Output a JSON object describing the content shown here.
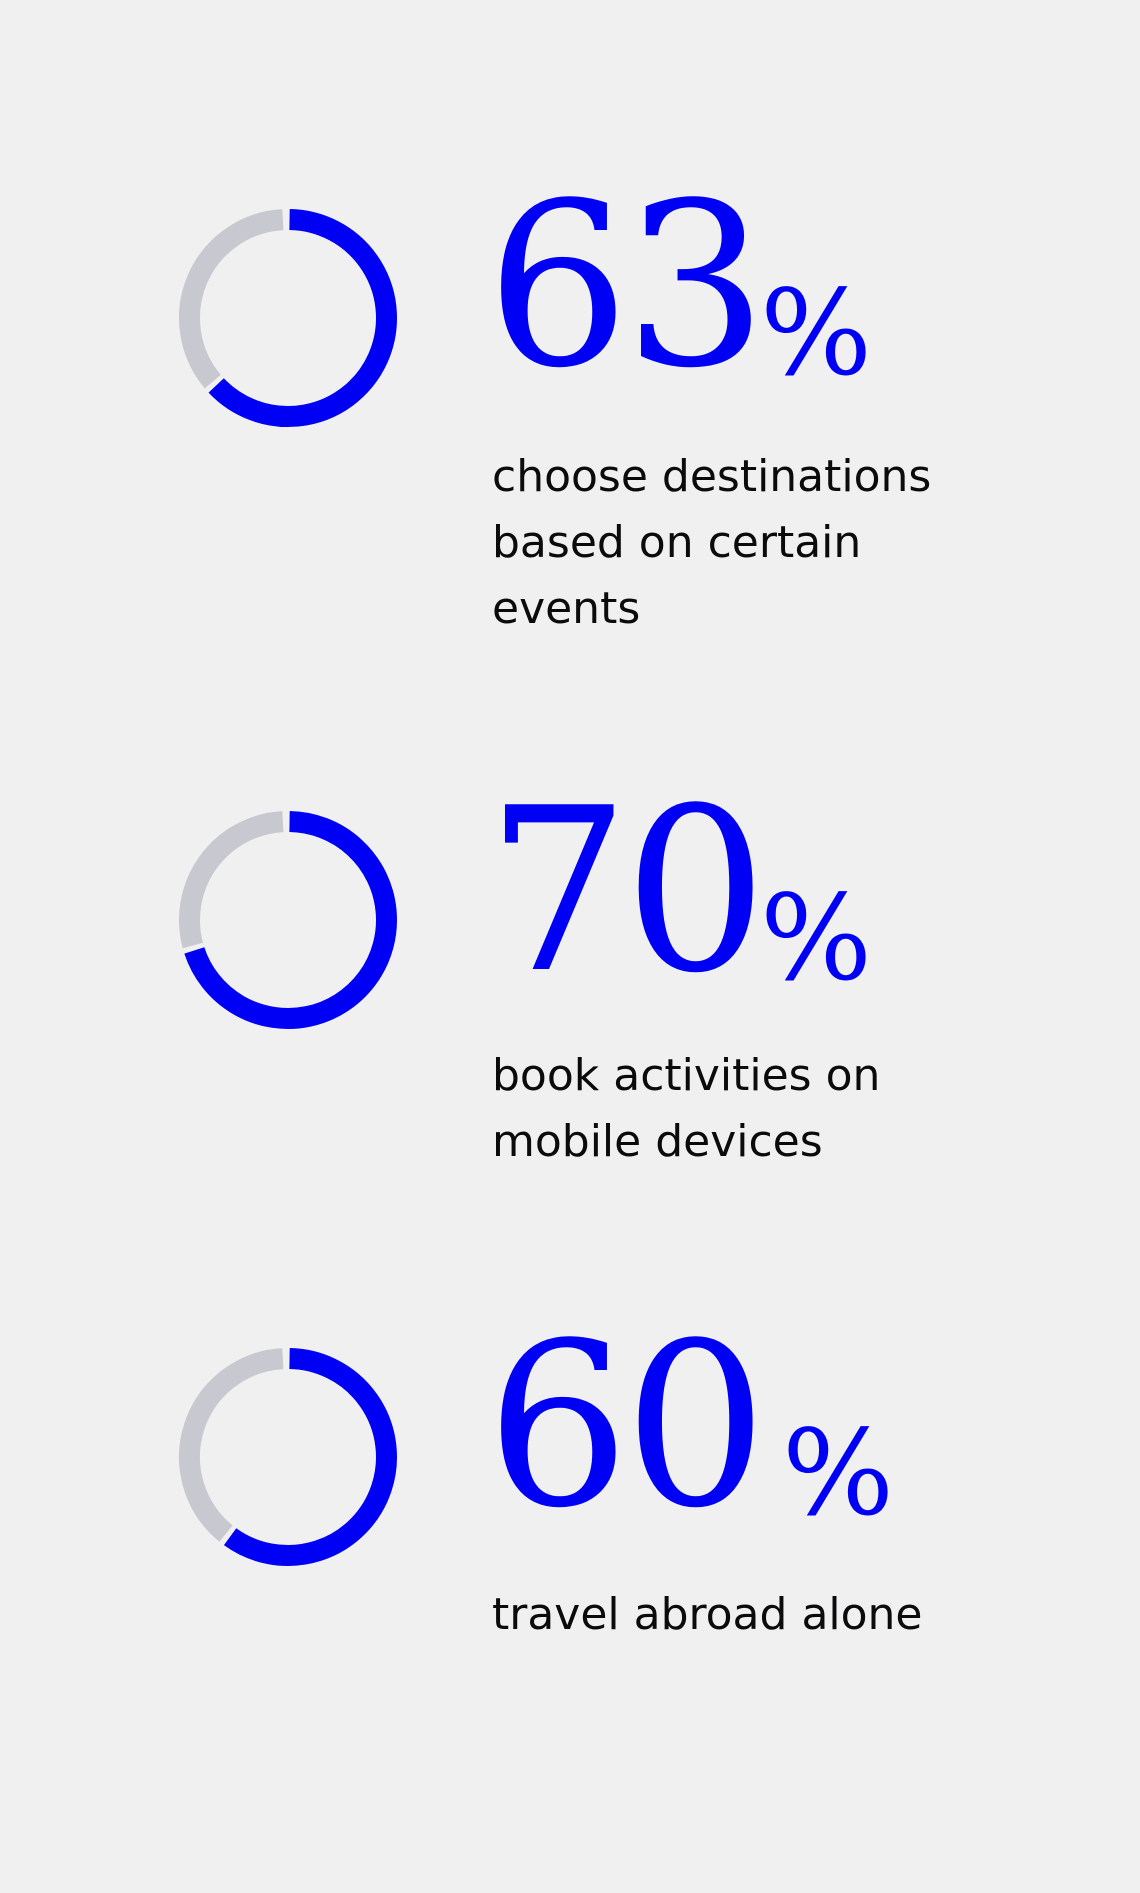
{
  "colors": {
    "background": "#f0f0f1",
    "accent": "#0000f5",
    "track": "#c8c9d0",
    "text": "#0b0b0b"
  },
  "chart_data": {
    "type": "donut",
    "stats": [
      {
        "value": 63,
        "number": "63",
        "unit": "%",
        "label": "choose destinations based on certain events"
      },
      {
        "value": 70,
        "number": "70",
        "unit": "%",
        "label": "book activities on mobile devices"
      },
      {
        "value": 60,
        "number": "60",
        "unit": "%",
        "label": "travel abroad alone"
      }
    ]
  }
}
